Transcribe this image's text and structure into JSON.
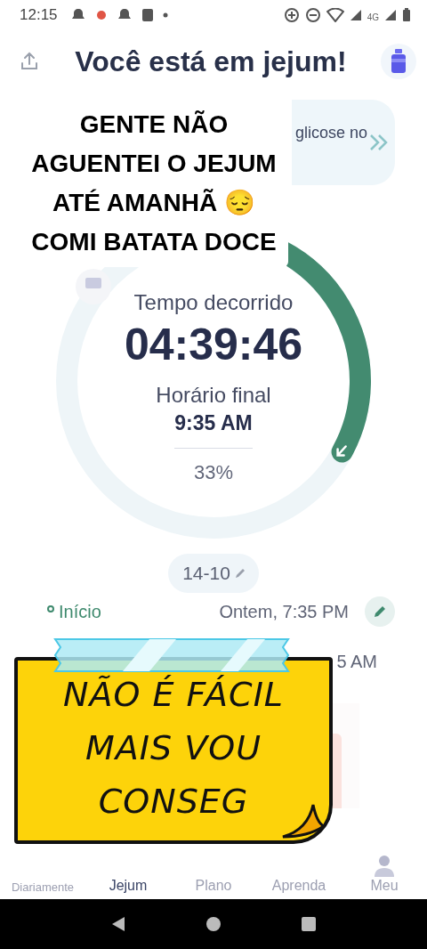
{
  "status_bar": {
    "time": "12:15",
    "network": "4G"
  },
  "header": {
    "title": "Você está em jejum!"
  },
  "banner": {
    "text": "glicose no"
  },
  "timer": {
    "elapsed_label": "Tempo decorrido",
    "elapsed": "04:39:46",
    "end_label": "Horário final",
    "end_time": "9:35 AM",
    "percent": "33%"
  },
  "plan": {
    "label": "14-10"
  },
  "times": [
    {
      "label": "Início",
      "value": "Ontem, 7:35 PM",
      "editable": true
    },
    {
      "value": "5 AM"
    }
  ],
  "nav": [
    {
      "label": "Diariamente",
      "selected": false
    },
    {
      "label": "Jejum",
      "selected": true
    },
    {
      "label": "Plano",
      "selected": false
    },
    {
      "label": "Aprenda",
      "selected": false
    },
    {
      "label": "Meu",
      "selected": false,
      "icon": true
    }
  ],
  "caption": {
    "lines": [
      "GENTE NÃO",
      "AGUENTEI O JEJUM",
      "ATÉ AMANHÃ 😔",
      "COMI BATATA DOCE"
    ]
  },
  "sticker": {
    "lines": [
      "NÃO É FÁCIL",
      "MAIS VOU",
      "CONSEG"
    ]
  }
}
